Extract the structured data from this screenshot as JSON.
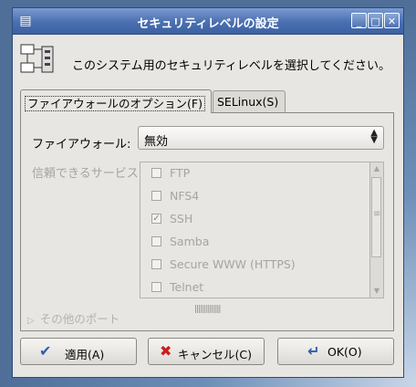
{
  "window": {
    "title": "セキュリティレベルの設定",
    "controls": {
      "minimize": "_",
      "maximize": "□",
      "close": "✕"
    }
  },
  "header": {
    "message": "このシステム用のセキュリティレベルを選択してください。",
    "icon": "security-computer-icon"
  },
  "tabs": [
    {
      "label": "ファイアウォールのオプション(F)",
      "active": true
    },
    {
      "label": "SELinux(S)",
      "active": false
    }
  ],
  "firewall": {
    "label": "ファイアウォール:",
    "selected": "無効"
  },
  "services": {
    "label": "信頼できるサービス:",
    "items": [
      {
        "label": "FTP",
        "checked": false
      },
      {
        "label": "NFS4",
        "checked": false
      },
      {
        "label": "SSH",
        "checked": true
      },
      {
        "label": "Samba",
        "checked": false
      },
      {
        "label": "Secure WWW (HTTPS)",
        "checked": false
      },
      {
        "label": "Telnet",
        "checked": false
      }
    ]
  },
  "other_ports": {
    "label": "その他のポート"
  },
  "buttons": {
    "apply": "適用(A)",
    "cancel": "キャンセル(C)",
    "ok": "OK(O)"
  },
  "colors": {
    "titlebar": "#4a6fb0",
    "window_bg": "#e8e6e2",
    "disabled_text": "#a6a49f"
  }
}
